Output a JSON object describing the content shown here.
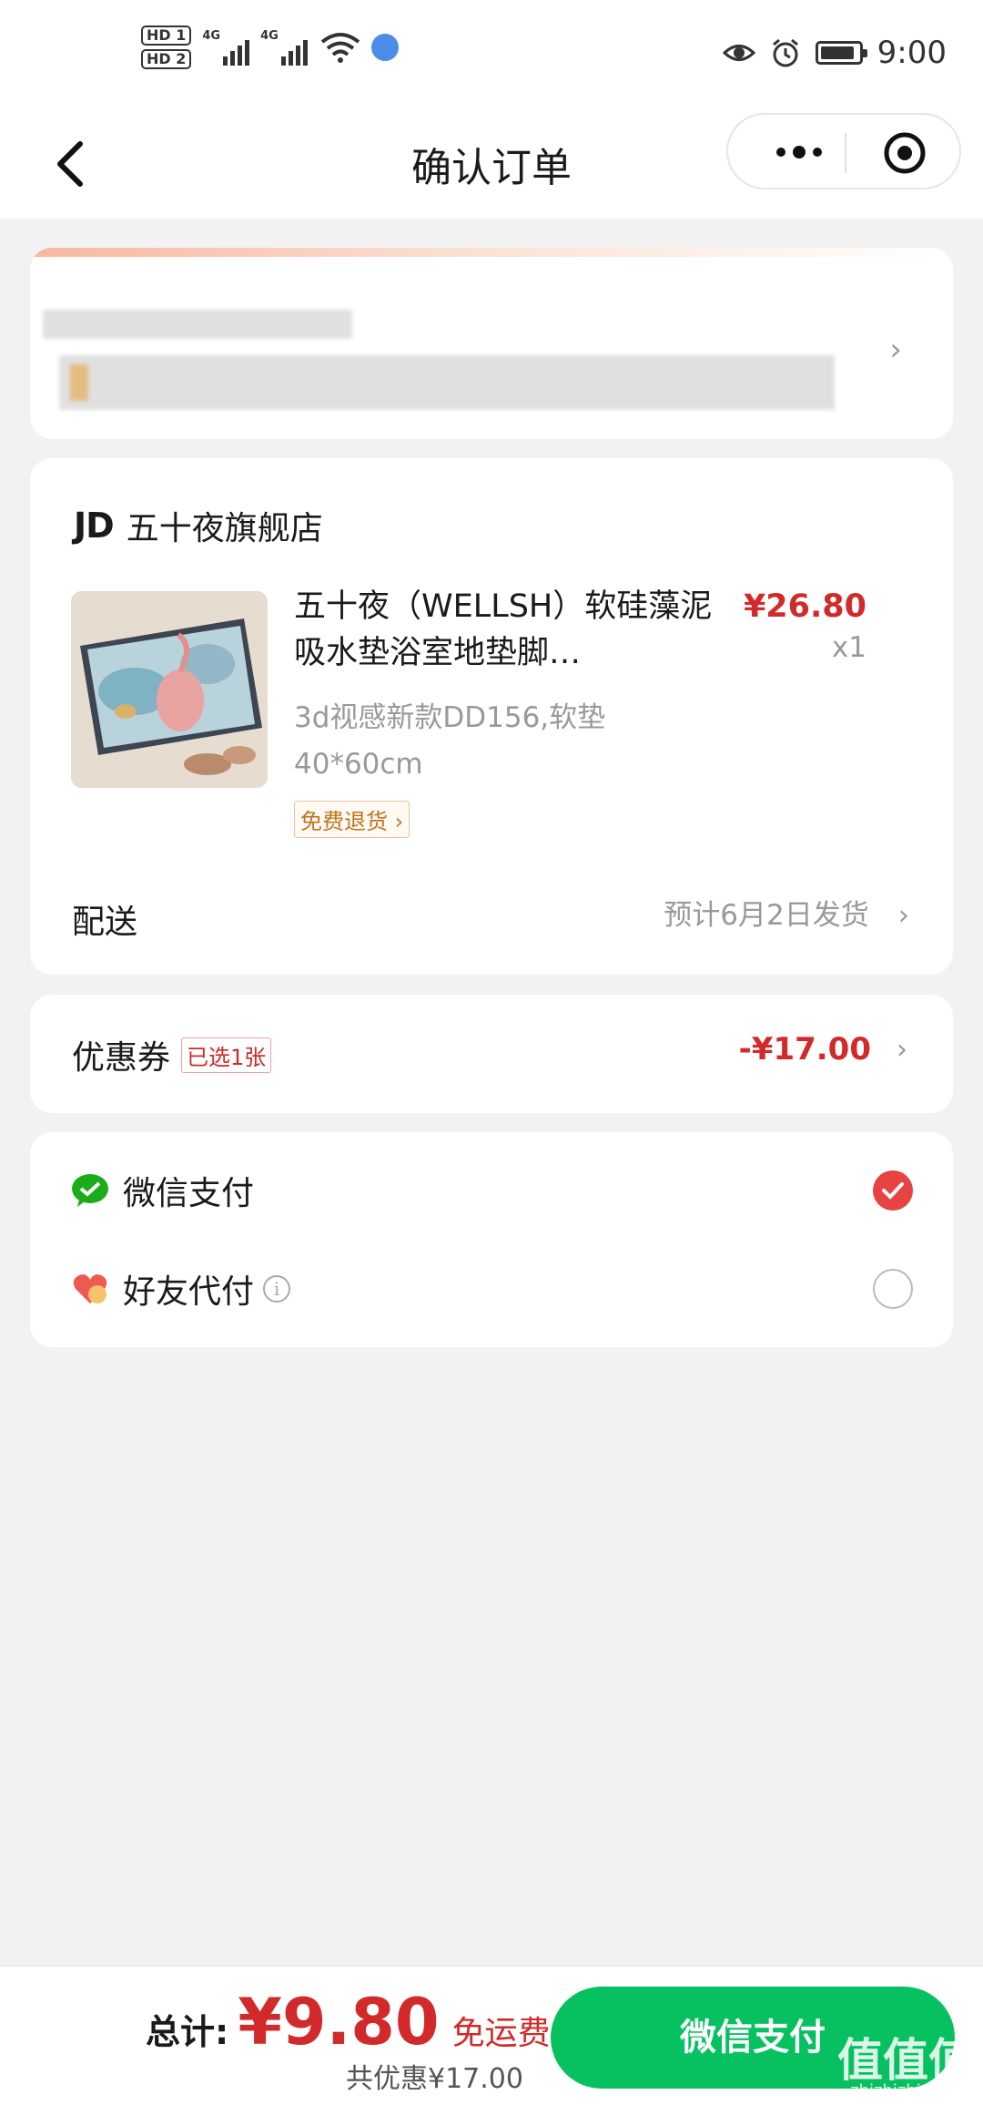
{
  "status_bar": {
    "sim1": "HD 1",
    "sim2": "HD 2",
    "net1": "4G",
    "net2": "4G",
    "time": "9:00",
    "icons": [
      "hd-icon",
      "signal-icon",
      "wifi-icon",
      "globe-icon",
      "eye-icon",
      "alarm-icon",
      "battery-icon"
    ]
  },
  "nav": {
    "title": "确认订单",
    "back_icon": "back-chevron-icon",
    "more_icon": "more-dots-icon",
    "close_icon": "target-icon"
  },
  "address": {
    "redacted": true,
    "chevron": "›"
  },
  "shop": {
    "logo": "JD",
    "name": "五十夜旗舰店",
    "product": {
      "title": "五十夜（WELLSH）软硅藻泥吸水垫浴室地垫脚…",
      "price": "¥26.80",
      "qty": "x1",
      "spec": "3d视感新款DD156,软垫40*60cm",
      "badge": "免费退货 ›"
    },
    "shipping_label": "配送",
    "shipping_value": "预计6月2日发货",
    "chevron": "›"
  },
  "coupon": {
    "label": "优惠券",
    "tag": "已选1张",
    "value": "-¥17.00",
    "chevron": "›"
  },
  "payment": {
    "options": [
      {
        "name": "微信支付",
        "icon": "wechat-pay-icon",
        "selected": true
      },
      {
        "name": "好友代付",
        "icon": "friend-pay-heart-icon",
        "selected": false,
        "info": "i"
      }
    ]
  },
  "bottom": {
    "total_label": "总计:",
    "amount": "¥9.80",
    "free_shipping": "免运费",
    "saved": "共优惠¥17.00",
    "pay_button": "微信支付",
    "watermark": "值值值",
    "watermark_sub": "zhizhizhi.com"
  },
  "colors": {
    "accent_red": "#d22a2a",
    "wechat_green": "#07c160",
    "radio_red": "#e84343"
  }
}
